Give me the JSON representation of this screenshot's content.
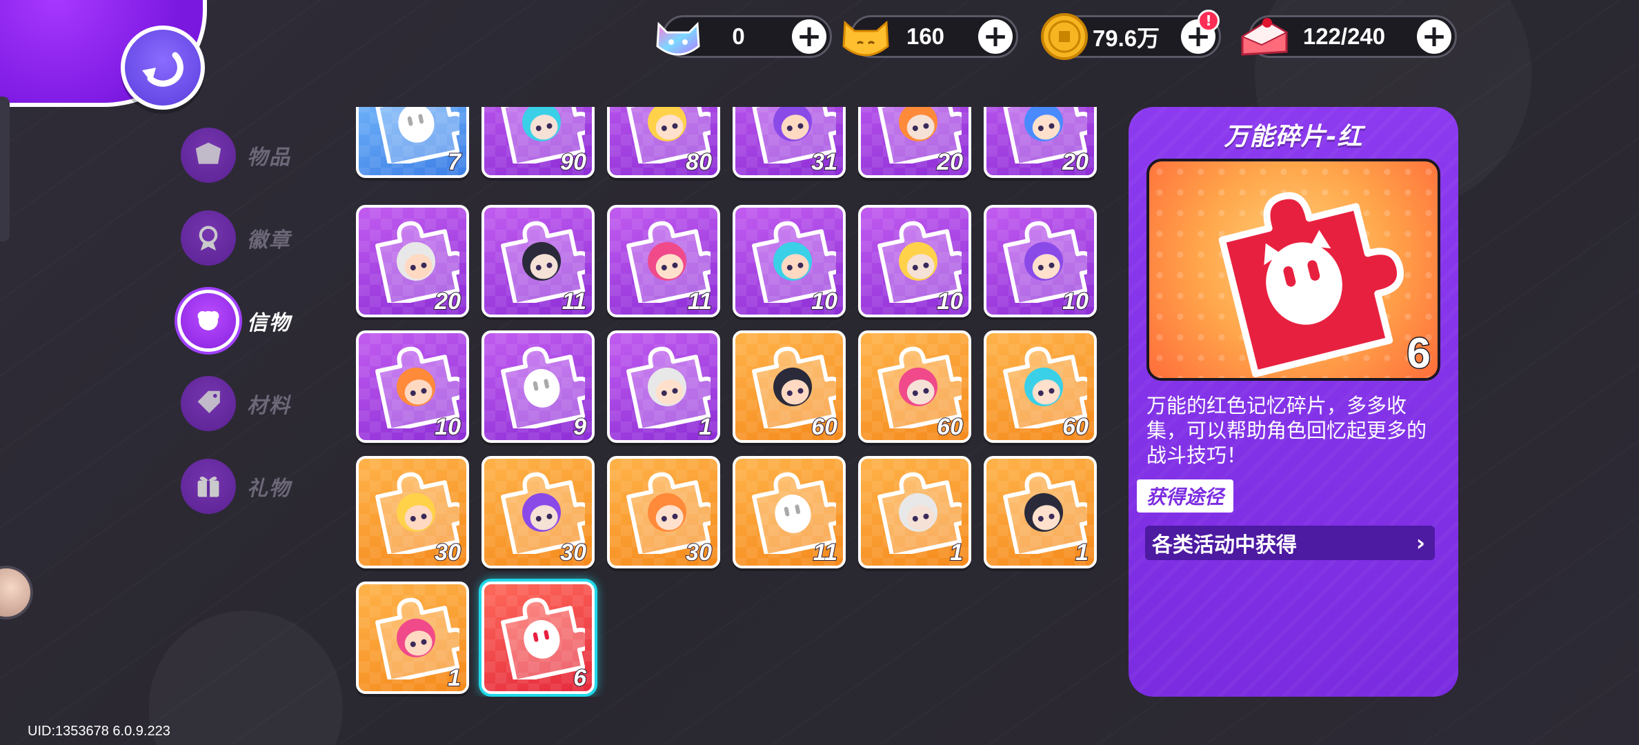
{
  "currencies": [
    {
      "name": "rainbow-cat",
      "value": "0",
      "icon": "rainbow-cat-gem-icon"
    },
    {
      "name": "gold-cat",
      "value": "160",
      "icon": "gold-cat-coin-icon"
    },
    {
      "name": "gold-coin",
      "value": "79.6万",
      "icon": "gold-coin-icon",
      "badge": "!"
    },
    {
      "name": "cake",
      "value": "122/240",
      "icon": "cake-stamina-icon"
    }
  ],
  "nav": {
    "items": [
      {
        "label": "物品",
        "icon": "hat-box-icon",
        "active": false
      },
      {
        "label": "徽章",
        "icon": "medal-icon",
        "active": false
      },
      {
        "label": "信物",
        "icon": "token-flower-icon",
        "active": true
      },
      {
        "label": "材料",
        "icon": "tag-icon",
        "active": false
      },
      {
        "label": "礼物",
        "icon": "gift-icon",
        "active": false
      }
    ]
  },
  "items": [
    {
      "count": "7",
      "color": "blue"
    },
    {
      "count": "90",
      "color": "purple"
    },
    {
      "count": "80",
      "color": "purple"
    },
    {
      "count": "31",
      "color": "purple"
    },
    {
      "count": "20",
      "color": "purple"
    },
    {
      "count": "20",
      "color": "purple"
    },
    {
      "count": "20",
      "color": "purple"
    },
    {
      "count": "11",
      "color": "purple"
    },
    {
      "count": "11",
      "color": "purple"
    },
    {
      "count": "10",
      "color": "purple"
    },
    {
      "count": "10",
      "color": "purple"
    },
    {
      "count": "10",
      "color": "purple"
    },
    {
      "count": "10",
      "color": "purple"
    },
    {
      "count": "9",
      "color": "purple"
    },
    {
      "count": "1",
      "color": "purple"
    },
    {
      "count": "60",
      "color": "orange"
    },
    {
      "count": "60",
      "color": "orange"
    },
    {
      "count": "60",
      "color": "orange"
    },
    {
      "count": "30",
      "color": "orange"
    },
    {
      "count": "30",
      "color": "orange"
    },
    {
      "count": "30",
      "color": "orange"
    },
    {
      "count": "11",
      "color": "orange"
    },
    {
      "count": "1",
      "color": "orange"
    },
    {
      "count": "1",
      "color": "orange"
    },
    {
      "count": "1",
      "color": "orange"
    },
    {
      "count": "6",
      "color": "red",
      "selected": true
    }
  ],
  "detail": {
    "title": "万能碎片-红",
    "count": "6",
    "description": "万能的红色记忆碎片，多多收集，可以帮助角色回忆起更多的战斗技巧！",
    "source_label": "获得途径",
    "source": "各类活动中获得"
  },
  "uid": "UID:1353678 6.0.9.223"
}
